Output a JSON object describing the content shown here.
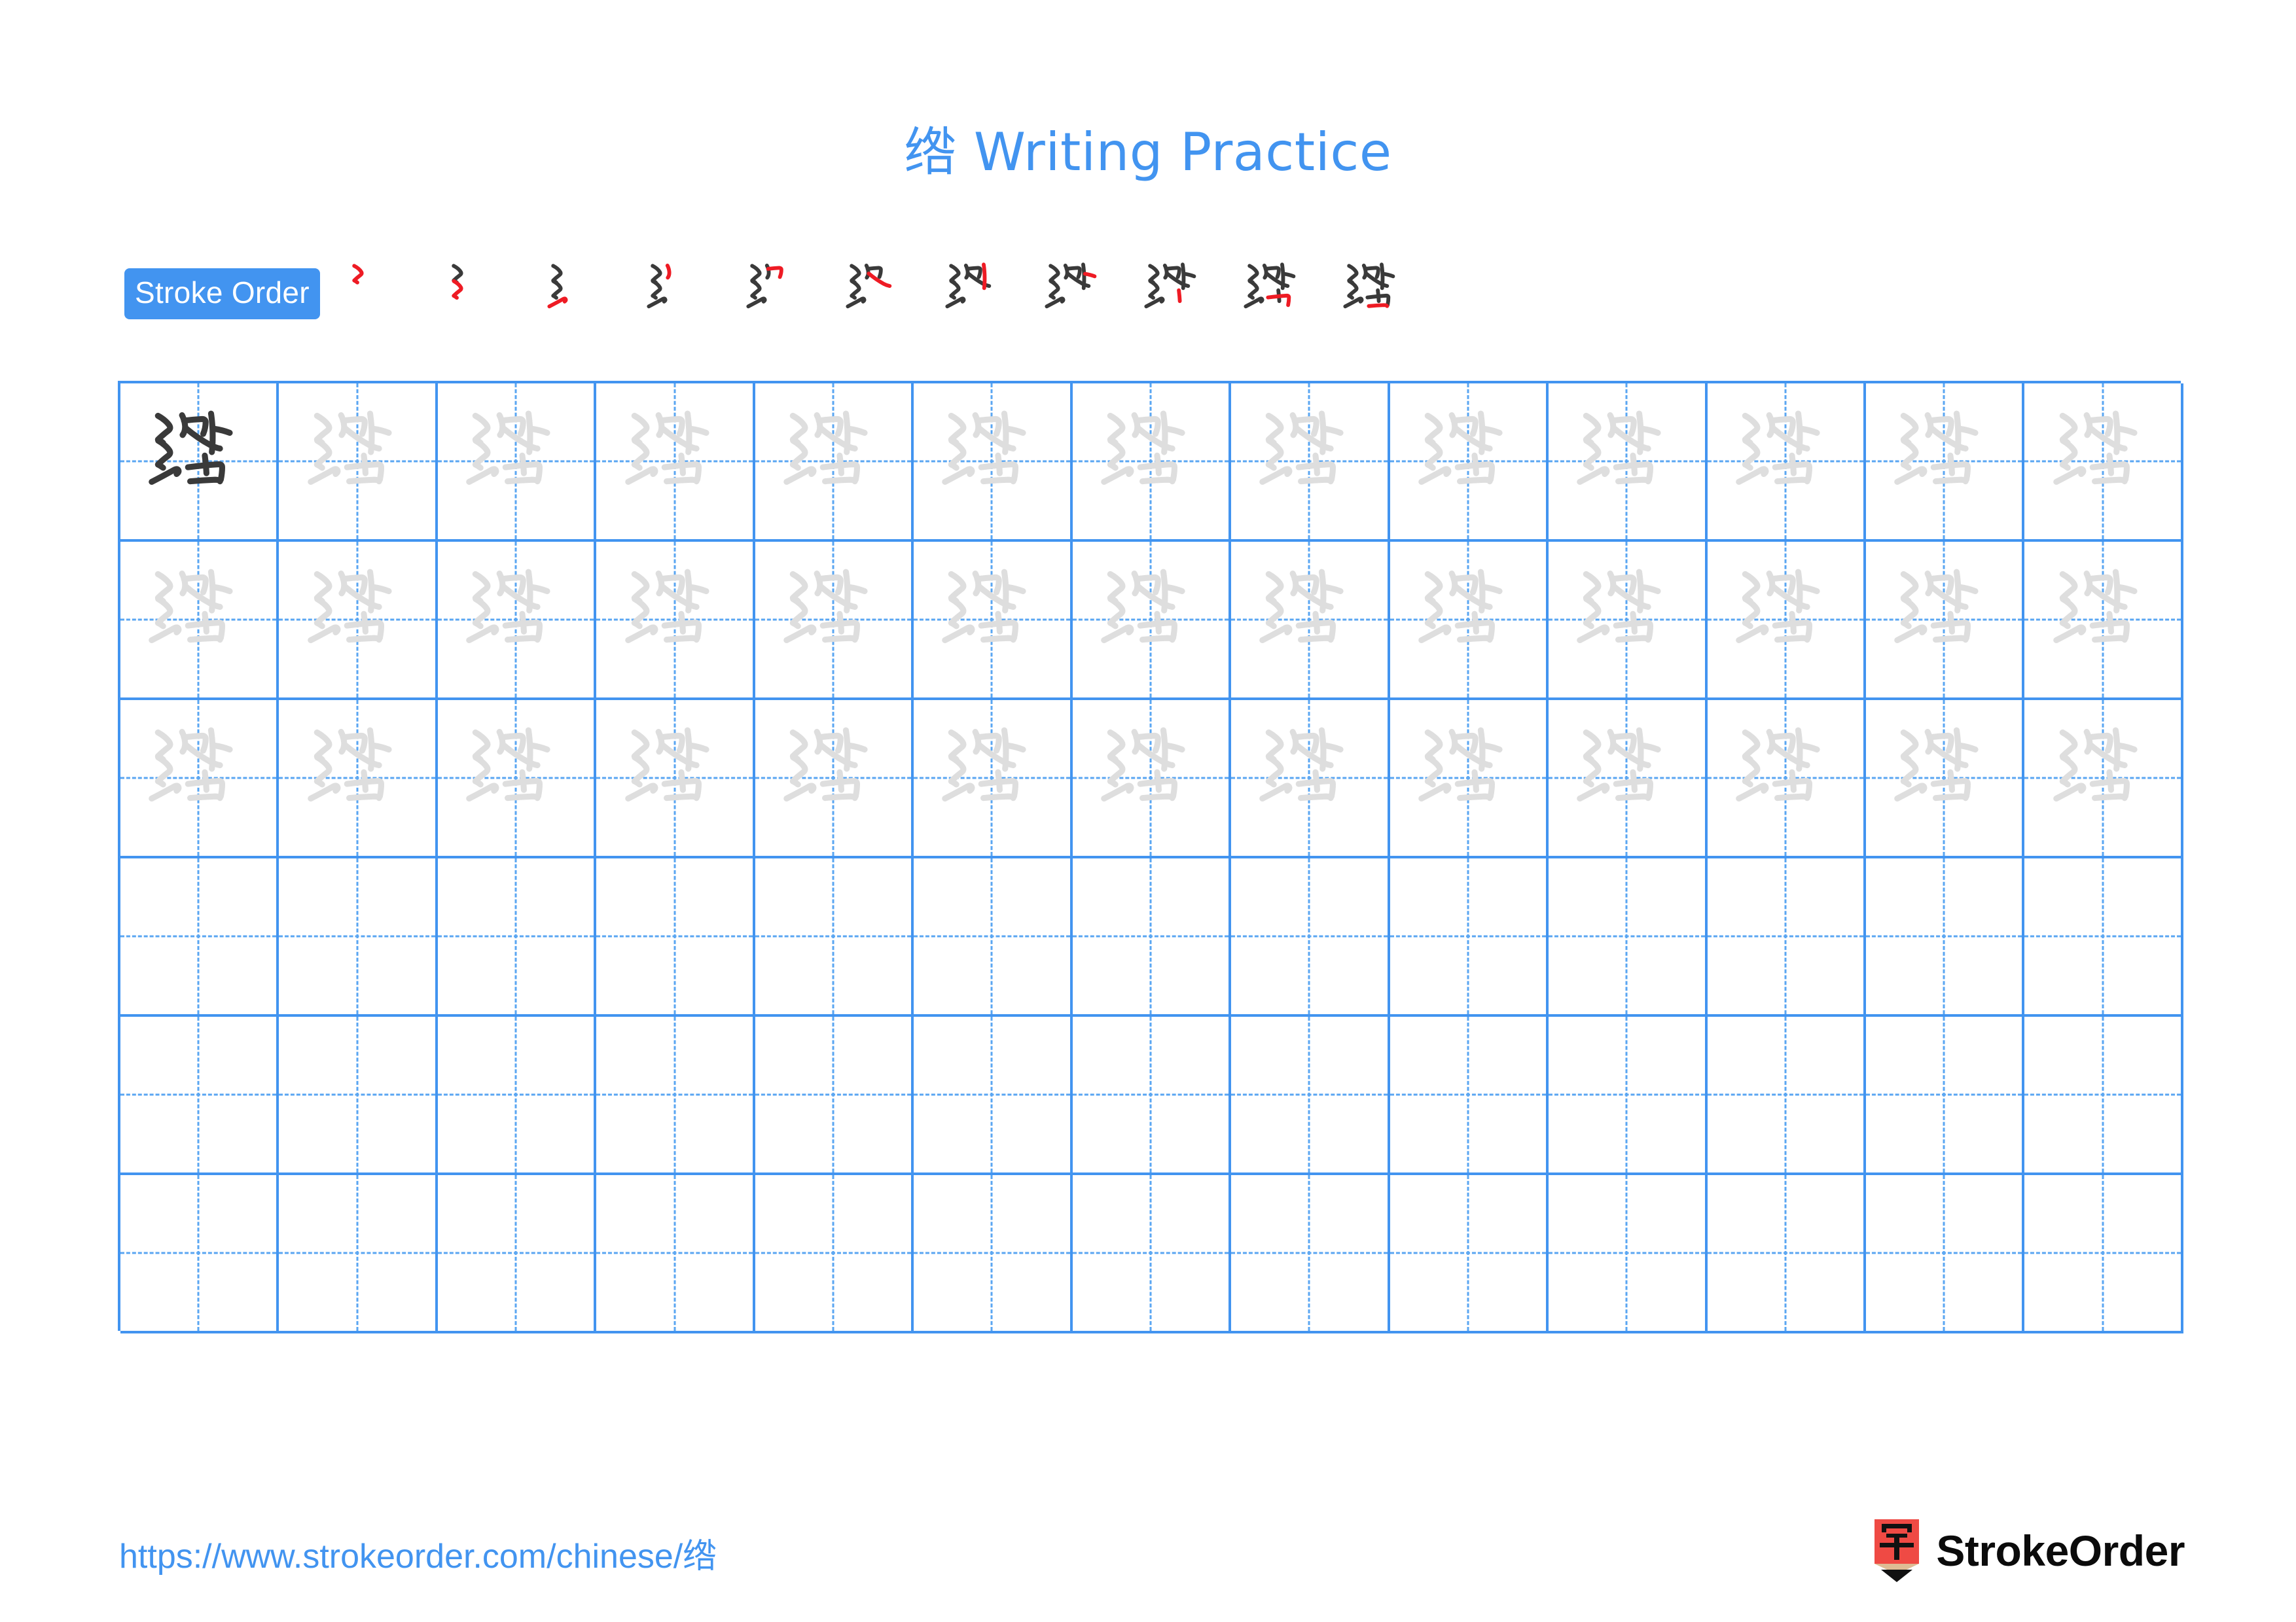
{
  "character": "绺",
  "title": {
    "character": "绺",
    "suffix": " Writing Practice",
    "full": "绺 Writing Practice",
    "color": "#4294F0"
  },
  "stroke_order": {
    "badge_label": "Stroke Order",
    "badge_bg": "#4294F0",
    "badge_text_color": "#ffffff",
    "stroke_count": 11,
    "new_stroke_color": "#EE1B24",
    "existing_stroke_color": "#3A3A3A",
    "steps": [
      {
        "index": 1,
        "strokes_shown": 1,
        "new_stroke": 1
      },
      {
        "index": 2,
        "strokes_shown": 2,
        "new_stroke": 2
      },
      {
        "index": 3,
        "strokes_shown": 3,
        "new_stroke": 3
      },
      {
        "index": 4,
        "strokes_shown": 4,
        "new_stroke": 4
      },
      {
        "index": 5,
        "strokes_shown": 5,
        "new_stroke": 5
      },
      {
        "index": 6,
        "strokes_shown": 6,
        "new_stroke": 6
      },
      {
        "index": 7,
        "strokes_shown": 7,
        "new_stroke": 7
      },
      {
        "index": 8,
        "strokes_shown": 8,
        "new_stroke": 8
      },
      {
        "index": 9,
        "strokes_shown": 9,
        "new_stroke": 9
      },
      {
        "index": 10,
        "strokes_shown": 10,
        "new_stroke": 10
      },
      {
        "index": 11,
        "strokes_shown": 11,
        "new_stroke": 11
      }
    ]
  },
  "practice_grid": {
    "columns": 13,
    "rows": 6,
    "grid_line_color": "#4294F0",
    "guide_line_color": "#5AA6F2",
    "model_char_color": "#3A3A3A",
    "trace_char_color": "#DEDEDE",
    "rows_data": [
      {
        "row": 1,
        "cells": [
          "model",
          "trace",
          "trace",
          "trace",
          "trace",
          "trace",
          "trace",
          "trace",
          "trace",
          "trace",
          "trace",
          "trace",
          "trace"
        ]
      },
      {
        "row": 2,
        "cells": [
          "trace",
          "trace",
          "trace",
          "trace",
          "trace",
          "trace",
          "trace",
          "trace",
          "trace",
          "trace",
          "trace",
          "trace",
          "trace"
        ]
      },
      {
        "row": 3,
        "cells": [
          "trace",
          "trace",
          "trace",
          "trace",
          "trace",
          "trace",
          "trace",
          "trace",
          "trace",
          "trace",
          "trace",
          "trace",
          "trace"
        ]
      },
      {
        "row": 4,
        "cells": [
          "empty",
          "empty",
          "empty",
          "empty",
          "empty",
          "empty",
          "empty",
          "empty",
          "empty",
          "empty",
          "empty",
          "empty",
          "empty"
        ]
      },
      {
        "row": 5,
        "cells": [
          "empty",
          "empty",
          "empty",
          "empty",
          "empty",
          "empty",
          "empty",
          "empty",
          "empty",
          "empty",
          "empty",
          "empty",
          "empty"
        ]
      },
      {
        "row": 6,
        "cells": [
          "empty",
          "empty",
          "empty",
          "empty",
          "empty",
          "empty",
          "empty",
          "empty",
          "empty",
          "empty",
          "empty",
          "empty",
          "empty"
        ]
      }
    ]
  },
  "footer": {
    "url": "https://www.strokeorder.com/chinese/绺",
    "url_color": "#4294F0",
    "brand_name": "StrokeOrder",
    "brand_mark_char": "字",
    "brand_mark_bg": "#EF4A44",
    "brand_mark_wood": "#DEBC94",
    "brand_mark_tip": "#111111"
  }
}
